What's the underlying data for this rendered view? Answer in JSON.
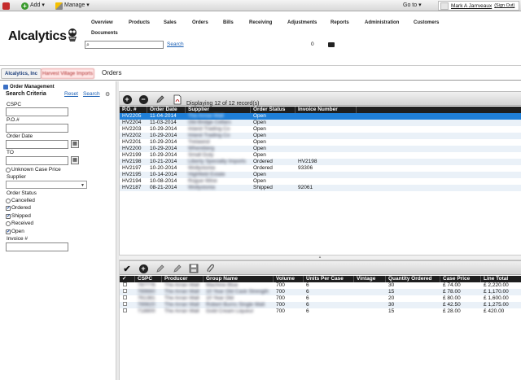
{
  "topbar": {
    "add_label": "Add ▾",
    "manage_label": "Manage ▾",
    "goto_label": "Go to ▾",
    "user_name": "Mark A Jarrveaux",
    "sign_out": "(Sign Out)"
  },
  "header": {
    "logo_text": "Alcalytics",
    "nav": [
      "Overview",
      "Products",
      "Sales",
      "Orders",
      "Bills",
      "Receiving",
      "Adjustments",
      "Reports",
      "Administration",
      "Customers"
    ],
    "nav_second_row": "Documents",
    "search_link": "Search",
    "count": "0"
  },
  "tabs": {
    "tab1": "Alcalytics, Inc",
    "tab2": "Harvest Village Imports",
    "tab3": "Orders"
  },
  "left": {
    "module_title": "Order Management",
    "search_criteria": "Search Criteria",
    "reset": "Reset",
    "search": "Search",
    "cspc_label": "CSPC",
    "po_label": "P.O.#",
    "order_date_label": "Order Date",
    "to_label": "TO",
    "unknown_case_price": "Unknown Case Price",
    "supplier_label": "Supplier",
    "order_status_label": "Order Status",
    "statuses": [
      {
        "label": "Cancelled",
        "checked": false
      },
      {
        "label": "Ordered",
        "checked": true
      },
      {
        "label": "Shipped",
        "checked": true
      },
      {
        "label": "Received",
        "checked": false
      },
      {
        "label": "Open",
        "checked": true
      }
    ],
    "invoice_label": "Invoice #"
  },
  "orders": {
    "displaying": "Displaying 12 of 12 record(s)",
    "columns": [
      "P.O. #",
      "Order Date",
      "Supplier",
      "Order Status",
      "Invoice Number"
    ],
    "rows": [
      {
        "po": "HV2205",
        "date": "11-04-2014",
        "supplier": "The Arrow Wall",
        "status": "Open",
        "invoice": ""
      },
      {
        "po": "HV2204",
        "date": "11-03-2014",
        "supplier": "Old Bridge Cellars",
        "status": "Open",
        "invoice": ""
      },
      {
        "po": "HV2203",
        "date": "10-29-2014",
        "supplier": "Inland Trading Co",
        "status": "Open",
        "invoice": ""
      },
      {
        "po": "HV2202",
        "date": "10-29-2014",
        "supplier": "Inland Trading Co",
        "status": "Open",
        "invoice": ""
      },
      {
        "po": "HV2201",
        "date": "10-29-2014",
        "supplier": "Trelawnd",
        "status": "Open",
        "invoice": ""
      },
      {
        "po": "HV2200",
        "date": "10-29-2014",
        "supplier": "Whereberg",
        "status": "Open",
        "invoice": ""
      },
      {
        "po": "HV2199",
        "date": "10-29-2014",
        "supplier": "Small Duty",
        "status": "Open",
        "invoice": ""
      },
      {
        "po": "HV2198",
        "date": "10-21-2014",
        "supplier": "Liberty Specialty Imports",
        "status": "Ordered",
        "invoice": "HV2198"
      },
      {
        "po": "HV2197",
        "date": "10-20-2014",
        "supplier": "Wollystonia",
        "status": "Ordered",
        "invoice": "93306"
      },
      {
        "po": "HV2195",
        "date": "10-14-2014",
        "supplier": "Highfield Estate",
        "status": "Open",
        "invoice": ""
      },
      {
        "po": "HV2194",
        "date": "10-08-2014",
        "supplier": "Rogue Wine",
        "status": "Open",
        "invoice": ""
      },
      {
        "po": "HV2187",
        "date": "08-21-2014",
        "supplier": "Wollystonia",
        "status": "Shipped",
        "invoice": "92061"
      }
    ]
  },
  "lines": {
    "columns": [
      "✓",
      "CSPC",
      "Producer",
      "Group Name",
      "Volume",
      "Units Per Case",
      "Vintage",
      "Quantity Ordered",
      "Case Price",
      "Line Total"
    ],
    "rows": [
      {
        "cspc": "787776",
        "producer": "The Arran Wall",
        "group": "Machine Blue",
        "volume": "700",
        "units": "6",
        "vintage": "",
        "qty": "30",
        "price": "£ 74.00",
        "total": "£ 2,220.00"
      },
      {
        "cspc": "789660",
        "producer": "The Arran Wall",
        "group": "10 Year Old Cask Strength",
        "volume": "700",
        "units": "6",
        "vintage": "",
        "qty": "15",
        "price": "£ 78.00",
        "total": "£ 1,170.00"
      },
      {
        "cspc": "761381",
        "producer": "The Arran Wall",
        "group": "10 Year Old",
        "volume": "700",
        "units": "6",
        "vintage": "",
        "qty": "20",
        "price": "£ 80.00",
        "total": "£ 1,600.00"
      },
      {
        "cspc": "789820",
        "producer": "The Arran Wall",
        "group": "Robert Burns Single Malt",
        "volume": "700",
        "units": "6",
        "vintage": "",
        "qty": "30",
        "price": "£ 42.50",
        "total": "£ 1,275.00"
      },
      {
        "cspc": "718800",
        "producer": "The Arran Wall",
        "group": "Gold Cream Liqueur",
        "volume": "700",
        "units": "6",
        "vintage": "",
        "qty": "15",
        "price": "£ 28.00",
        "total": "£ 420.00"
      }
    ]
  },
  "icons": {
    "add": "plus-circle-icon",
    "remove": "minus-circle-icon",
    "edit": "pencil-icon",
    "pdf": "pdf-icon",
    "check": "checkmark-icon",
    "save": "floppy-icon",
    "attach": "paperclip-icon",
    "calendar": "calendar-icon",
    "search": "magnifier-icon"
  }
}
